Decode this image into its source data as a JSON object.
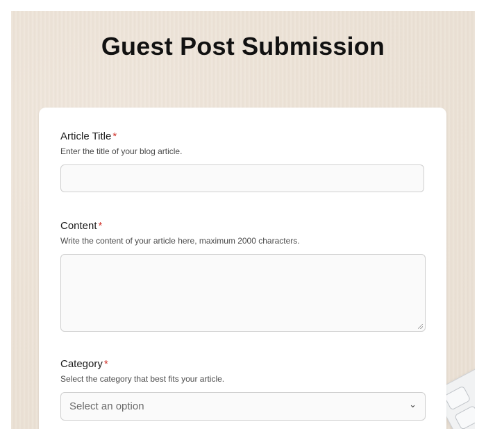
{
  "page": {
    "title": "Guest Post Submission"
  },
  "form": {
    "fields": [
      {
        "label": "Article Title",
        "required_mark": "*",
        "help": "Enter the title of your blog article.",
        "value": ""
      },
      {
        "label": "Content",
        "required_mark": "*",
        "help": "Write the content of your article here, maximum 2000 characters.",
        "value": ""
      },
      {
        "label": "Category",
        "required_mark": "*",
        "help": "Select the category that best fits your article.",
        "placeholder": "Select an option"
      }
    ]
  },
  "icons": {
    "select_chevron": "chevron-down-icon"
  },
  "colors": {
    "required": "#d0342c",
    "card_background": "#ffffff",
    "page_background": "#ece2d6"
  }
}
